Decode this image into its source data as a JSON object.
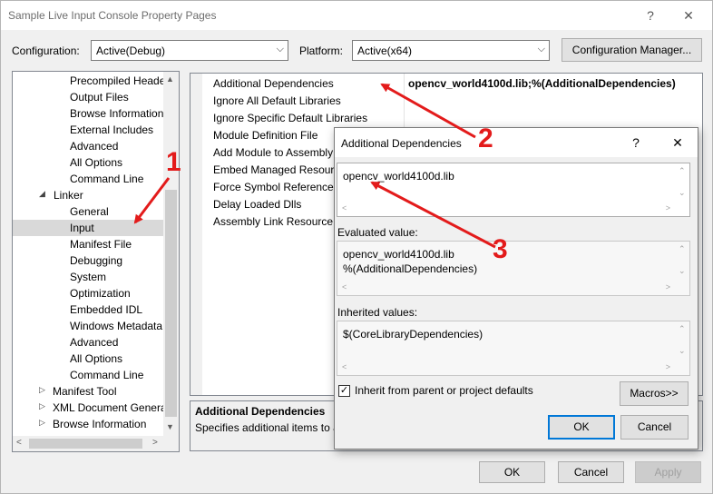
{
  "window": {
    "title": "Sample Live Input Console Property Pages",
    "help_label": "?",
    "close_label": "✕"
  },
  "toolbar": {
    "configuration_label": "Configuration:",
    "configuration_value": "Active(Debug)",
    "platform_label": "Platform:",
    "platform_value": "Active(x64)",
    "config_manager_label": "Configuration Manager..."
  },
  "tree": {
    "items": [
      {
        "label": "Precompiled Heade",
        "indent": 3
      },
      {
        "label": "Output Files",
        "indent": 3
      },
      {
        "label": "Browse Information",
        "indent": 3
      },
      {
        "label": "External Includes",
        "indent": 3
      },
      {
        "label": "Advanced",
        "indent": 3
      },
      {
        "label": "All Options",
        "indent": 3
      },
      {
        "label": "Command Line",
        "indent": 3
      },
      {
        "label": "Linker",
        "indent": 2,
        "expander": "◢"
      },
      {
        "label": "General",
        "indent": 3
      },
      {
        "label": "Input",
        "indent": 3,
        "selected": true
      },
      {
        "label": "Manifest File",
        "indent": 3
      },
      {
        "label": "Debugging",
        "indent": 3
      },
      {
        "label": "System",
        "indent": 3
      },
      {
        "label": "Optimization",
        "indent": 3
      },
      {
        "label": "Embedded IDL",
        "indent": 3
      },
      {
        "label": "Windows Metadata",
        "indent": 3
      },
      {
        "label": "Advanced",
        "indent": 3
      },
      {
        "label": "All Options",
        "indent": 3
      },
      {
        "label": "Command Line",
        "indent": 3
      },
      {
        "label": "Manifest Tool",
        "indent": 1,
        "expander": "▷"
      },
      {
        "label": "XML Document Genera",
        "indent": 1,
        "expander": "▷"
      },
      {
        "label": "Browse Information",
        "indent": 1,
        "expander": "▷"
      }
    ]
  },
  "properties": [
    {
      "name": "Additional Dependencies",
      "value": "opencv_world4100d.lib;%(AdditionalDependencies)"
    },
    {
      "name": "Ignore All Default Libraries",
      "value": ""
    },
    {
      "name": "Ignore Specific Default Libraries",
      "value": ""
    },
    {
      "name": "Module Definition File",
      "value": ""
    },
    {
      "name": "Add Module to Assembly",
      "value": ""
    },
    {
      "name": "Embed Managed Resource",
      "value": ""
    },
    {
      "name": "Force Symbol References",
      "value": ""
    },
    {
      "name": "Delay Loaded Dlls",
      "value": ""
    },
    {
      "name": "Assembly Link Resource",
      "value": ""
    }
  ],
  "description": {
    "heading": "Additional Dependencies",
    "text": "Specifies additional items to a"
  },
  "footer": {
    "ok": "OK",
    "cancel": "Cancel",
    "apply": "Apply"
  },
  "dialog": {
    "title": "Additional Dependencies",
    "help_label": "?",
    "close_label": "✕",
    "input_value": "opencv_world4100d.lib",
    "evaluated_label": "Evaluated value:",
    "evaluated_value": "opencv_world4100d.lib\n%(AdditionalDependencies)",
    "inherited_label": "Inherited values:",
    "inherited_value": "$(CoreLibraryDependencies)",
    "inherit_checkbox_label": "Inherit from parent or project defaults",
    "inherit_checked": true,
    "macros_label": "Macros>>",
    "ok": "OK",
    "cancel": "Cancel"
  },
  "annotations": {
    "color": "#e31b1b",
    "labels": [
      "1",
      "2",
      "3"
    ]
  }
}
